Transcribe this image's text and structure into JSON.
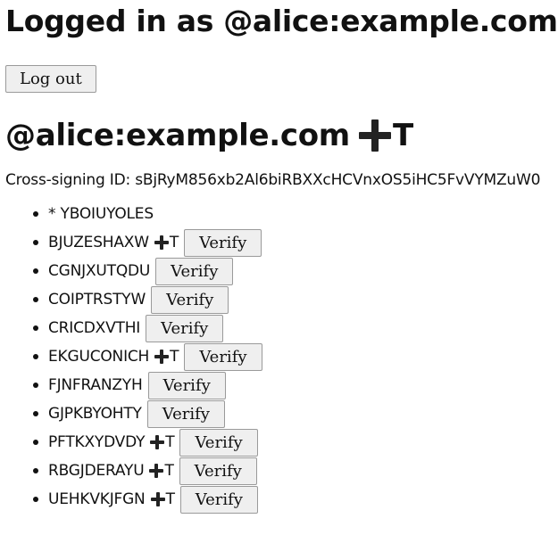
{
  "header": {
    "logged_in_text": "Logged in as @alice:example.com"
  },
  "logout_button": {
    "label": "Log out"
  },
  "user": {
    "id": "@alice:example.com",
    "trust_icon": "cross-icon",
    "trust_letter": "T"
  },
  "cross_signing": {
    "text": "Cross-signing ID: sBjRyM856xb2Al6biRBXXcHCVnxOS5iHC5FvVYMZuW0"
  },
  "devices": {
    "current": {
      "label": "* YBOIUYOLES"
    },
    "items": [
      {
        "id": "BJUZESHAXW",
        "trusted": true,
        "trust_letter": "T",
        "verify_label": "Verify"
      },
      {
        "id": "CGNJXUTQDU",
        "trusted": false,
        "trust_letter": "",
        "verify_label": "Verify"
      },
      {
        "id": "COIPTRSTYW",
        "trusted": false,
        "trust_letter": "",
        "verify_label": "Verify"
      },
      {
        "id": "CRICDXVTHI",
        "trusted": false,
        "trust_letter": "",
        "verify_label": "Verify"
      },
      {
        "id": "EKGUCONICH",
        "trusted": true,
        "trust_letter": "T",
        "verify_label": "Verify"
      },
      {
        "id": "FJNFRANZYH",
        "trusted": false,
        "trust_letter": "",
        "verify_label": "Verify"
      },
      {
        "id": "GJPKBYOHTY",
        "trusted": false,
        "trust_letter": "",
        "verify_label": "Verify"
      },
      {
        "id": "PFTKXYDVDY",
        "trusted": true,
        "trust_letter": "T",
        "verify_label": "Verify"
      },
      {
        "id": "RBGJDERAYU",
        "trusted": true,
        "trust_letter": "T",
        "verify_label": "Verify"
      },
      {
        "id": "UEHKVKJFGN",
        "trusted": true,
        "trust_letter": "T",
        "verify_label": "Verify"
      }
    ]
  }
}
